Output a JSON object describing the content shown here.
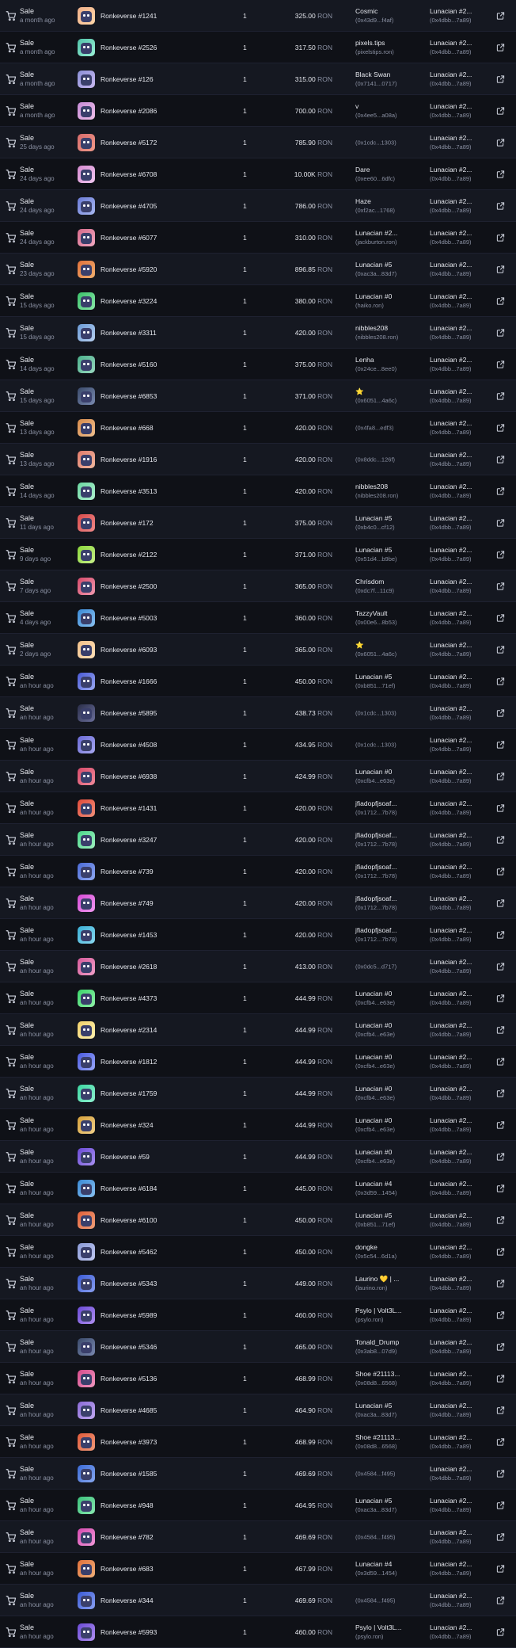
{
  "icons": {
    "row_icon": "cart-icon",
    "link_icon": "external-link-icon"
  },
  "currency": "RON",
  "rows": [
    {
      "event": "Sale",
      "time": "a month ago",
      "item": "Ronkeverse #1241",
      "qty": "1",
      "price": "325.00",
      "from_name": "Cosmic",
      "from_addr": "(0x43d9...f4af)",
      "to_name": "Lunacian #2...",
      "to_addr": "(0x4dbb...7a89)",
      "thumb": [
        "#f0b08a",
        "#ffd6a8"
      ]
    },
    {
      "event": "Sale",
      "time": "a month ago",
      "item": "Ronkeverse #2526",
      "qty": "1",
      "price": "317.50",
      "from_name": "pixels.tips",
      "from_addr": "(pixelstips.ron)",
      "to_name": "Lunacian #2...",
      "to_addr": "(0x4dbb...7a89)",
      "thumb": [
        "#4fc2a8",
        "#9cf0d6"
      ]
    },
    {
      "event": "Sale",
      "time": "a month ago",
      "item": "Ronkeverse #126",
      "qty": "1",
      "price": "315.00",
      "from_name": "Black Swan",
      "from_addr": "(0x7141...0717)",
      "to_name": "Lunacian #2...",
      "to_addr": "(0x4dbb...7a89)",
      "thumb": [
        "#8a8fd6",
        "#c9b8f0"
      ]
    },
    {
      "event": "Sale",
      "time": "a month ago",
      "item": "Ronkeverse #2086",
      "qty": "1",
      "price": "700.00",
      "from_name": "v",
      "from_addr": "(0x4ee5...a08a)",
      "to_name": "Lunacian #2...",
      "to_addr": "(0x4dbb...7a89)",
      "thumb": [
        "#c48ad6",
        "#f0c0e8"
      ]
    },
    {
      "event": "Sale",
      "time": "25 days ago",
      "item": "Ronkeverse #5172",
      "qty": "1",
      "price": "785.90",
      "from_name": "",
      "from_addr": "(0x1cdc...1303)",
      "to_name": "Lunacian #2...",
      "to_addr": "(0x4dbb...7a89)",
      "thumb": [
        "#d66a6a",
        "#f09a8a"
      ]
    },
    {
      "event": "Sale",
      "time": "24 days ago",
      "item": "Ronkeverse #6708",
      "qty": "1",
      "price": "10.00K",
      "from_name": "Dare",
      "from_addr": "(0xee60...6dfc)",
      "to_name": "Lunacian #2...",
      "to_addr": "(0x4dbb...7a89)",
      "thumb": [
        "#d68ad0",
        "#f0c8f0"
      ]
    },
    {
      "event": "Sale",
      "time": "24 days ago",
      "item": "Ronkeverse #4705",
      "qty": "1",
      "price": "786.00",
      "from_name": "Haze",
      "from_addr": "(0xf2ac...1768)",
      "to_name": "Lunacian #2...",
      "to_addr": "(0x4dbb...7a89)",
      "thumb": [
        "#6a7ad6",
        "#a8b8f0"
      ]
    },
    {
      "event": "Sale",
      "time": "24 days ago",
      "item": "Ronkeverse #6077",
      "qty": "1",
      "price": "310.00",
      "from_name": "Lunacian #2...",
      "from_addr": "(jackburton.ron)",
      "to_name": "Lunacian #2...",
      "to_addr": "(0x4dbb...7a89)",
      "thumb": [
        "#d66a8a",
        "#f0a8c0"
      ]
    },
    {
      "event": "Sale",
      "time": "23 days ago",
      "item": "Ronkeverse #5920",
      "qty": "1",
      "price": "896.85",
      "from_name": "Lunacian #5",
      "from_addr": "(0xac3a...83d7)",
      "to_name": "Lunacian #2...",
      "to_addr": "(0x4dbb...7a89)",
      "thumb": [
        "#e0703a",
        "#f0b070"
      ]
    },
    {
      "event": "Sale",
      "time": "15 days ago",
      "item": "Ronkeverse #3224",
      "qty": "1",
      "price": "380.00",
      "from_name": "Lunacian #0",
      "from_addr": "(haiko.ron)",
      "to_name": "Lunacian #2...",
      "to_addr": "(0x4dbb...7a89)",
      "thumb": [
        "#3ac06a",
        "#8ae8a8"
      ]
    },
    {
      "event": "Sale",
      "time": "15 days ago",
      "item": "Ronkeverse #3311",
      "qty": "1",
      "price": "420.00",
      "from_name": "nibbles208",
      "from_addr": "(nibbles208.ron)",
      "to_name": "Lunacian #2...",
      "to_addr": "(0x4dbb...7a89)",
      "thumb": [
        "#6a9ad6",
        "#b8d0f0"
      ]
    },
    {
      "event": "Sale",
      "time": "14 days ago",
      "item": "Ronkeverse #5160",
      "qty": "1",
      "price": "375.00",
      "from_name": "Lenha",
      "from_addr": "(0x24ce...8ee0)",
      "to_name": "Lunacian #2...",
      "to_addr": "(0x4dbb...7a89)",
      "thumb": [
        "#4ab08a",
        "#9ad8c0"
      ]
    },
    {
      "event": "Sale",
      "time": "15 days ago",
      "item": "Ronkeverse #6853",
      "qty": "1",
      "price": "371.00",
      "from_name": "⭐",
      "from_addr": "(0x6051...4a6c)",
      "to_name": "Lunacian #2...",
      "to_addr": "(0x4dbb...7a89)",
      "thumb": [
        "#3a4a6a",
        "#7a8ab0"
      ]
    },
    {
      "event": "Sale",
      "time": "13 days ago",
      "item": "Ronkeverse #668",
      "qty": "1",
      "price": "420.00",
      "from_name": "",
      "from_addr": "(0x4fa8...edf3)",
      "to_name": "Lunacian #2...",
      "to_addr": "(0x4dbb...7a89)",
      "thumb": [
        "#d68a4a",
        "#f0c090"
      ]
    },
    {
      "event": "Sale",
      "time": "13 days ago",
      "item": "Ronkeverse #1916",
      "qty": "1",
      "price": "420.00",
      "from_name": "",
      "from_addr": "(0x8ddc...126f)",
      "to_name": "Lunacian #2...",
      "to_addr": "(0x4dbb...7a89)",
      "thumb": [
        "#e07a6a",
        "#f0b8a0"
      ]
    },
    {
      "event": "Sale",
      "time": "14 days ago",
      "item": "Ronkeverse #3513",
      "qty": "1",
      "price": "420.00",
      "from_name": "nibbles208",
      "from_addr": "(nibbles208.ron)",
      "to_name": "Lunacian #2...",
      "to_addr": "(0x4dbb...7a89)",
      "thumb": [
        "#6ad6a0",
        "#b0f0d0"
      ]
    },
    {
      "event": "Sale",
      "time": "11 days ago",
      "item": "Ronkeverse #172",
      "qty": "1",
      "price": "375.00",
      "from_name": "Lunacian #5",
      "from_addr": "(0xb4c0...cf12)",
      "to_name": "Lunacian #2...",
      "to_addr": "(0x4dbb...7a89)",
      "thumb": [
        "#d64a4a",
        "#f08a8a"
      ]
    },
    {
      "event": "Sale",
      "time": "9 days ago",
      "item": "Ronkeverse #2122",
      "qty": "1",
      "price": "371.00",
      "from_name": "Lunacian #5",
      "from_addr": "(0x51d4...b9be)",
      "to_name": "Lunacian #2...",
      "to_addr": "(0x4dbb...7a89)",
      "thumb": [
        "#8ad63a",
        "#c8f08a"
      ]
    },
    {
      "event": "Sale",
      "time": "7 days ago",
      "item": "Ronkeverse #2500",
      "qty": "1",
      "price": "365.00",
      "from_name": "Chrisdom",
      "from_addr": "(0xdc7f...11c9)",
      "to_name": "Lunacian #2...",
      "to_addr": "(0x4dbb...7a89)",
      "thumb": [
        "#d64a6a",
        "#f09ab0"
      ]
    },
    {
      "event": "Sale",
      "time": "4 days ago",
      "item": "Ronkeverse #5003",
      "qty": "1",
      "price": "360.00",
      "from_name": "TazzyVault",
      "from_addr": "(0x00e6...8b53)",
      "to_name": "Lunacian #2...",
      "to_addr": "(0x4dbb...7a89)",
      "thumb": [
        "#3a8ad6",
        "#8ac0f0"
      ]
    },
    {
      "event": "Sale",
      "time": "2 days ago",
      "item": "Ronkeverse #6093",
      "qty": "1",
      "price": "365.00",
      "from_name": "⭐",
      "from_addr": "(0x6051...4a6c)",
      "to_name": "Lunacian #2...",
      "to_addr": "(0x4dbb...7a89)",
      "thumb": [
        "#f0c08a",
        "#ffe0b8"
      ]
    },
    {
      "event": "Sale",
      "time": "an hour ago",
      "item": "Ronkeverse #1666",
      "qty": "1",
      "price": "450.00",
      "from_name": "Lunacian #5",
      "from_addr": "(0xb851...71ef)",
      "to_name": "Lunacian #2...",
      "to_addr": "(0x4dbb...7a89)",
      "thumb": [
        "#4a5ad6",
        "#9aa8f0"
      ]
    },
    {
      "event": "Sale",
      "time": "an hour ago",
      "item": "Ronkeverse #5895",
      "qty": "1",
      "price": "438.73",
      "from_name": "",
      "from_addr": "(0x1cdc...1303)",
      "to_name": "Lunacian #2...",
      "to_addr": "(0x4dbb...7a89)",
      "thumb": [
        "#2a2e4a",
        "#6a6e9a"
      ]
    },
    {
      "event": "Sale",
      "time": "an hour ago",
      "item": "Ronkeverse #4508",
      "qty": "1",
      "price": "434.95",
      "from_name": "",
      "from_addr": "(0x1cdc...1303)",
      "to_name": "Lunacian #2...",
      "to_addr": "(0x4dbb...7a89)",
      "thumb": [
        "#6a6ad6",
        "#a8a8f0"
      ]
    },
    {
      "event": "Sale",
      "time": "an hour ago",
      "item": "Ronkeverse #6938",
      "qty": "1",
      "price": "424.99",
      "from_name": "Lunacian #0",
      "from_addr": "(0xcfb4...e63e)",
      "to_name": "Lunacian #2...",
      "to_addr": "(0x4dbb...7a89)",
      "thumb": [
        "#d64a6a",
        "#f08a9a"
      ]
    },
    {
      "event": "Sale",
      "time": "an hour ago",
      "item": "Ronkeverse #1431",
      "qty": "1",
      "price": "420.00",
      "from_name": "jfiadopfjsoaf...",
      "from_addr": "(0x1712...7b78)",
      "to_name": "Lunacian #2...",
      "to_addr": "(0x4dbb...7a89)",
      "thumb": [
        "#e04a3a",
        "#f0907a"
      ]
    },
    {
      "event": "Sale",
      "time": "an hour ago",
      "item": "Ronkeverse #3247",
      "qty": "1",
      "price": "420.00",
      "from_name": "jfiadopfjsoaf...",
      "from_addr": "(0x1712...7b78)",
      "to_name": "Lunacian #2...",
      "to_addr": "(0x4dbb...7a89)",
      "thumb": [
        "#4ad68a",
        "#a0f0c0"
      ]
    },
    {
      "event": "Sale",
      "time": "an hour ago",
      "item": "Ronkeverse #739",
      "qty": "1",
      "price": "420.00",
      "from_name": "jfiadopfjsoaf...",
      "from_addr": "(0x1712...7b78)",
      "to_name": "Lunacian #2...",
      "to_addr": "(0x4dbb...7a89)",
      "thumb": [
        "#4a6ad6",
        "#90a8f0"
      ]
    },
    {
      "event": "Sale",
      "time": "an hour ago",
      "item": "Ronkeverse #749",
      "qty": "1",
      "price": "420.00",
      "from_name": "jfiadopfjsoaf...",
      "from_addr": "(0x1712...7b78)",
      "to_name": "Lunacian #2...",
      "to_addr": "(0x4dbb...7a89)",
      "thumb": [
        "#d64ad6",
        "#f09af0"
      ]
    },
    {
      "event": "Sale",
      "time": "an hour ago",
      "item": "Ronkeverse #1453",
      "qty": "1",
      "price": "420.00",
      "from_name": "jfiadopfjsoaf...",
      "from_addr": "(0x1712...7b78)",
      "to_name": "Lunacian #2...",
      "to_addr": "(0x4dbb...7a89)",
      "thumb": [
        "#3ab0d6",
        "#8ad8f0"
      ]
    },
    {
      "event": "Sale",
      "time": "an hour ago",
      "item": "Ronkeverse #2618",
      "qty": "1",
      "price": "413.00",
      "from_name": "",
      "from_addr": "(0x0dc5...d717)",
      "to_name": "Lunacian #2...",
      "to_addr": "(0x4dbb...7a89)",
      "thumb": [
        "#d65a9a",
        "#f0a0c8"
      ]
    },
    {
      "event": "Sale",
      "time": "an hour ago",
      "item": "Ronkeverse #4373",
      "qty": "1",
      "price": "444.99",
      "from_name": "Lunacian #0",
      "from_addr": "(0xcfb4...e63e)",
      "to_name": "Lunacian #2...",
      "to_addr": "(0x4dbb...7a89)",
      "thumb": [
        "#3ad66a",
        "#90f0a8"
      ]
    },
    {
      "event": "Sale",
      "time": "an hour ago",
      "item": "Ronkeverse #2314",
      "qty": "1",
      "price": "444.99",
      "from_name": "Lunacian #0",
      "from_addr": "(0xcfb4...e63e)",
      "to_name": "Lunacian #2...",
      "to_addr": "(0x4dbb...7a89)",
      "thumb": [
        "#f0d06a",
        "#fff0b0"
      ]
    },
    {
      "event": "Sale",
      "time": "an hour ago",
      "item": "Ronkeverse #1812",
      "qty": "1",
      "price": "444.99",
      "from_name": "Lunacian #0",
      "from_addr": "(0xcfb4...e63e)",
      "to_name": "Lunacian #2...",
      "to_addr": "(0x4dbb...7a89)",
      "thumb": [
        "#4a5ae0",
        "#9aa8f8"
      ]
    },
    {
      "event": "Sale",
      "time": "an hour ago",
      "item": "Ronkeverse #1759",
      "qty": "1",
      "price": "444.99",
      "from_name": "Lunacian #0",
      "from_addr": "(0xcfb4...e63e)",
      "to_name": "Lunacian #2...",
      "to_addr": "(0x4dbb...7a89)",
      "thumb": [
        "#3ad6a0",
        "#90f0d0"
      ]
    },
    {
      "event": "Sale",
      "time": "an hour ago",
      "item": "Ronkeverse #324",
      "qty": "1",
      "price": "444.99",
      "from_name": "Lunacian #0",
      "from_addr": "(0xcfb4...e63e)",
      "to_name": "Lunacian #2...",
      "to_addr": "(0x4dbb...7a89)",
      "thumb": [
        "#d6a03a",
        "#f0d08a"
      ]
    },
    {
      "event": "Sale",
      "time": "an hour ago",
      "item": "Ronkeverse #59",
      "qty": "1",
      "price": "444.99",
      "from_name": "Lunacian #0",
      "from_addr": "(0xcfb4...e63e)",
      "to_name": "Lunacian #2...",
      "to_addr": "(0x4dbb...7a89)",
      "thumb": [
        "#6a4ad6",
        "#a890f0"
      ]
    },
    {
      "event": "Sale",
      "time": "an hour ago",
      "item": "Ronkeverse #6184",
      "qty": "1",
      "price": "445.00",
      "from_name": "Lunacian #4",
      "from_addr": "(0x3d59...1454)",
      "to_name": "Lunacian #2...",
      "to_addr": "(0x4dbb...7a89)",
      "thumb": [
        "#3a8ad6",
        "#88c0f0"
      ]
    },
    {
      "event": "Sale",
      "time": "an hour ago",
      "item": "Ronkeverse #6100",
      "qty": "1",
      "price": "450.00",
      "from_name": "Lunacian #5",
      "from_addr": "(0xb851...71ef)",
      "to_name": "Lunacian #2...",
      "to_addr": "(0x4dbb...7a89)",
      "thumb": [
        "#e0603a",
        "#f0a07a"
      ]
    },
    {
      "event": "Sale",
      "time": "an hour ago",
      "item": "Ronkeverse #5462",
      "qty": "1",
      "price": "450.00",
      "from_name": "dongke",
      "from_addr": "(0x5c54...6d1a)",
      "to_name": "Lunacian #2...",
      "to_addr": "(0x4dbb...7a89)",
      "thumb": [
        "#8a9ad6",
        "#c0c8f0"
      ]
    },
    {
      "event": "Sale",
      "time": "an hour ago",
      "item": "Ronkeverse #5343",
      "qty": "1",
      "price": "449.00",
      "from_name": "Laurino 💛 | ...",
      "from_addr": "(laurino.ron)",
      "to_name": "Lunacian #2...",
      "to_addr": "(0x4dbb...7a89)",
      "thumb": [
        "#3a5ad6",
        "#8aa0f0"
      ]
    },
    {
      "event": "Sale",
      "time": "an hour ago",
      "item": "Ronkeverse #5989",
      "qty": "1",
      "price": "460.00",
      "from_name": "Psylo | Volt3L...",
      "from_addr": "(psylo.ron)",
      "to_name": "Lunacian #2...",
      "to_addr": "(0x4dbb...7a89)",
      "thumb": [
        "#6a4ad6",
        "#b090f0"
      ]
    },
    {
      "event": "Sale",
      "time": "an hour ago",
      "item": "Ronkeverse #5346",
      "qty": "1",
      "price": "465.00",
      "from_name": "Tonald_Drump",
      "from_addr": "(0x3ab8...07d9)",
      "to_name": "Lunacian #2...",
      "to_addr": "(0x4dbb...7a89)",
      "thumb": [
        "#3a4a6a",
        "#7a88b0"
      ]
    },
    {
      "event": "Sale",
      "time": "an hour ago",
      "item": "Ronkeverse #5136",
      "qty": "1",
      "price": "468.99",
      "from_name": "Shoe #21113...",
      "from_addr": "(0x08d8...6568)",
      "to_name": "Lunacian #2...",
      "to_addr": "(0x4dbb...7a89)",
      "thumb": [
        "#d64a8a",
        "#f098c0"
      ]
    },
    {
      "event": "Sale",
      "time": "an hour ago",
      "item": "Ronkeverse #4685",
      "qty": "1",
      "price": "464.90",
      "from_name": "Lunacian #5",
      "from_addr": "(0xac3a...83d7)",
      "to_name": "Lunacian #2...",
      "to_addr": "(0x4dbb...7a89)",
      "thumb": [
        "#8a6ad6",
        "#c0a8f0"
      ]
    },
    {
      "event": "Sale",
      "time": "an hour ago",
      "item": "Ronkeverse #3973",
      "qty": "1",
      "price": "468.99",
      "from_name": "Shoe #21113...",
      "from_addr": "(0x08d8...6568)",
      "to_name": "Lunacian #2...",
      "to_addr": "(0x4dbb...7a89)",
      "thumb": [
        "#e05a3a",
        "#f09a7a"
      ]
    },
    {
      "event": "Sale",
      "time": "an hour ago",
      "item": "Ronkeverse #1585",
      "qty": "1",
      "price": "469.69",
      "from_name": "",
      "from_addr": "(0x4584...f495)",
      "to_name": "Lunacian #2...",
      "to_addr": "(0x4dbb...7a89)",
      "thumb": [
        "#3a6ad6",
        "#88a8f0"
      ]
    },
    {
      "event": "Sale",
      "time": "an hour ago",
      "item": "Ronkeverse #948",
      "qty": "1",
      "price": "464.95",
      "from_name": "Lunacian #5",
      "from_addr": "(0xac3a...83d7)",
      "to_name": "Lunacian #2...",
      "to_addr": "(0x4dbb...7a89)",
      "thumb": [
        "#3ac07a",
        "#8ae8b0"
      ]
    },
    {
      "event": "Sale",
      "time": "an hour ago",
      "item": "Ronkeverse #782",
      "qty": "1",
      "price": "469.69",
      "from_name": "",
      "from_addr": "(0x4584...f495)",
      "to_name": "Lunacian #2...",
      "to_addr": "(0x4dbb...7a89)",
      "thumb": [
        "#d64ab0",
        "#f098d8"
      ]
    },
    {
      "event": "Sale",
      "time": "an hour ago",
      "item": "Ronkeverse #683",
      "qty": "1",
      "price": "467.99",
      "from_name": "Lunacian #4",
      "from_addr": "(0x3d59...1454)",
      "to_name": "Lunacian #2...",
      "to_addr": "(0x4dbb...7a89)",
      "thumb": [
        "#e0703a",
        "#f0b07a"
      ]
    },
    {
      "event": "Sale",
      "time": "an hour ago",
      "item": "Ronkeverse #344",
      "qty": "1",
      "price": "469.69",
      "from_name": "",
      "from_addr": "(0x4584...f495)",
      "to_name": "Lunacian #2...",
      "to_addr": "(0x4dbb...7a89)",
      "thumb": [
        "#3a5ad6",
        "#8aa0f0"
      ]
    },
    {
      "event": "Sale",
      "time": "an hour ago",
      "item": "Ronkeverse #5993",
      "qty": "1",
      "price": "460.00",
      "from_name": "Psylo | Volt3L...",
      "from_addr": "(psylo.ron)",
      "to_name": "Lunacian #2...",
      "to_addr": "(0x4dbb...7a89)",
      "thumb": [
        "#6a4ad6",
        "#b090f0"
      ]
    }
  ]
}
